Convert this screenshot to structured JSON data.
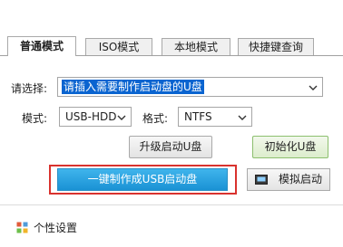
{
  "tabs": [
    {
      "label": "普通模式",
      "active": true
    },
    {
      "label": "ISO模式",
      "active": false
    },
    {
      "label": "本地模式",
      "active": false
    },
    {
      "label": "快捷键查询",
      "active": false
    }
  ],
  "device": {
    "label": "请选择:",
    "value": "请插入需要制作启动盘的U盘"
  },
  "mode": {
    "label": "模式:",
    "value": "USB-HDD"
  },
  "format": {
    "label": "格式:",
    "value": "NTFS"
  },
  "buttons": {
    "upgrade": "升级启动U盘",
    "init": "初始化U盘",
    "make": "一键制作成USB启动盘",
    "simulate": "模拟启动"
  },
  "footer": {
    "settings": "个性设置"
  },
  "colors": {
    "accent": "#1a92d4",
    "highlight_outline": "#d9322e",
    "selection": "#0a64d0",
    "init_button": "#dcedcc"
  },
  "icons": {
    "dropdown": "chevron-down-icon",
    "simulate": "monitor-icon",
    "settings": "grid-settings-icon"
  }
}
